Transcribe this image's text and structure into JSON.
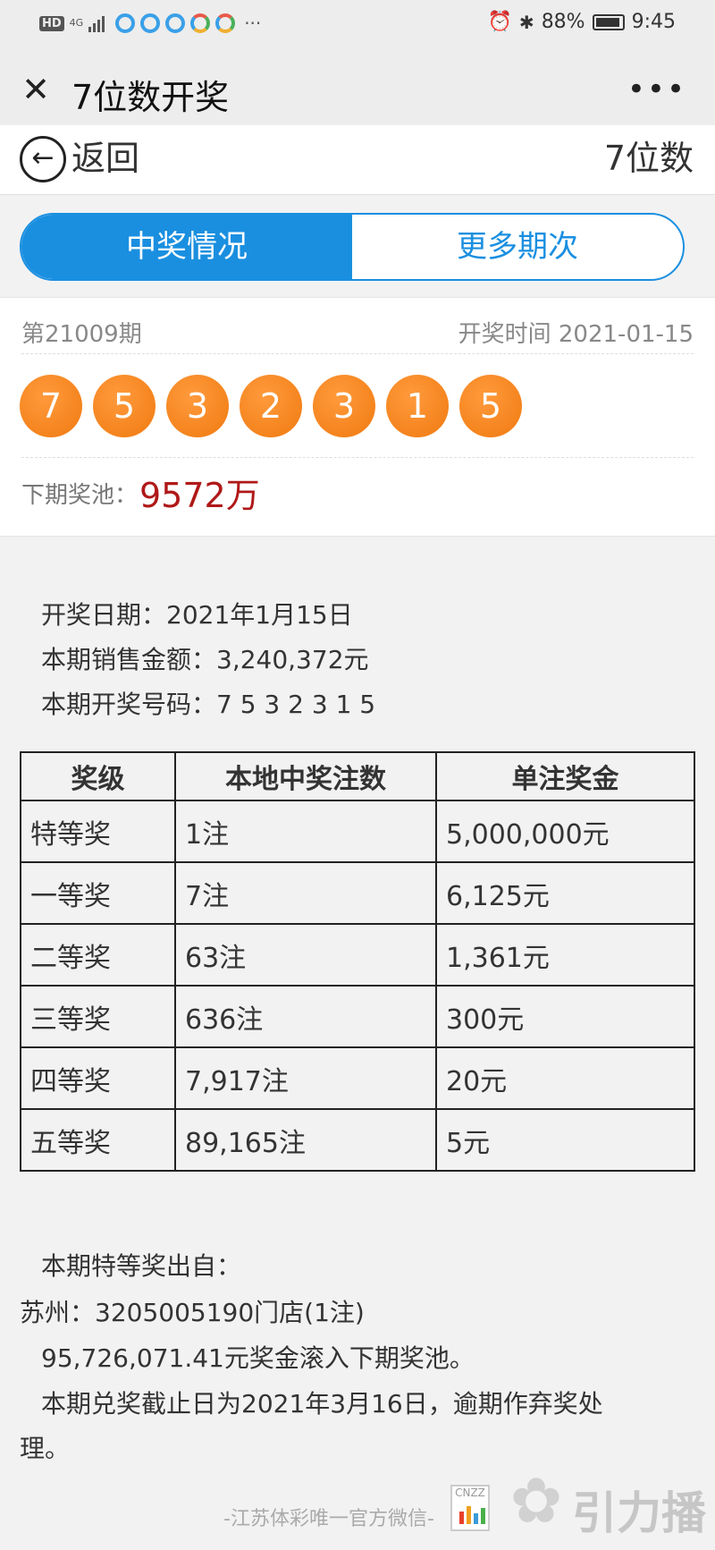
{
  "status_bar": {
    "hd": "HD",
    "network": "4G",
    "more_dots": "···",
    "battery": "88%",
    "time": "9:45"
  },
  "title_bar": {
    "close_icon": "close-icon",
    "title": "7位数开奖",
    "more_icon": "more-icon"
  },
  "back_row": {
    "back_label": "返回",
    "right_label": "7位数"
  },
  "tabs": [
    {
      "label": "中奖情况",
      "active": true
    },
    {
      "label": "更多期次",
      "active": false
    }
  ],
  "draw": {
    "issue": "第21009期",
    "draw_time": "开奖时间 2021-01-15",
    "numbers": [
      "7",
      "5",
      "3",
      "2",
      "3",
      "1",
      "5"
    ],
    "pool_label": "下期奖池：",
    "pool_value": "9572万"
  },
  "details": {
    "date_line": "开奖日期：2021年1月15日",
    "sales_line": "本期销售金额：3,240,372元",
    "numbers_line": "本期开奖号码：7 5 3 2 3 1 5"
  },
  "prize_table": {
    "headers": [
      "奖级",
      "本地中奖注数",
      "单注奖金"
    ],
    "rows": [
      [
        "特等奖",
        "1注",
        "5,000,000元"
      ],
      [
        "一等奖",
        "7注",
        "6,125元"
      ],
      [
        "二等奖",
        "63注",
        "1,361元"
      ],
      [
        "三等奖",
        "636注",
        "300元"
      ],
      [
        "四等奖",
        "7,917注",
        "20元"
      ],
      [
        "五等奖",
        "89,165注",
        "5元"
      ]
    ]
  },
  "notes": {
    "line1": "本期特等奖出自：",
    "line2": "苏州：3205005190门店(1注)",
    "line3": "95,726,071.41元奖金滚入下期奖池。",
    "line4": "本期兑奖截止日为2021年3月16日，逾期作弃奖处",
    "line5": "理。"
  },
  "footer": {
    "text": "-江苏体彩唯一官方微信-",
    "logo_text": "CNZZ",
    "watermark_text": "引力播"
  },
  "colors": {
    "accent": "#1a8fe0",
    "ball": "#f07a10",
    "pool": "#b01818"
  }
}
